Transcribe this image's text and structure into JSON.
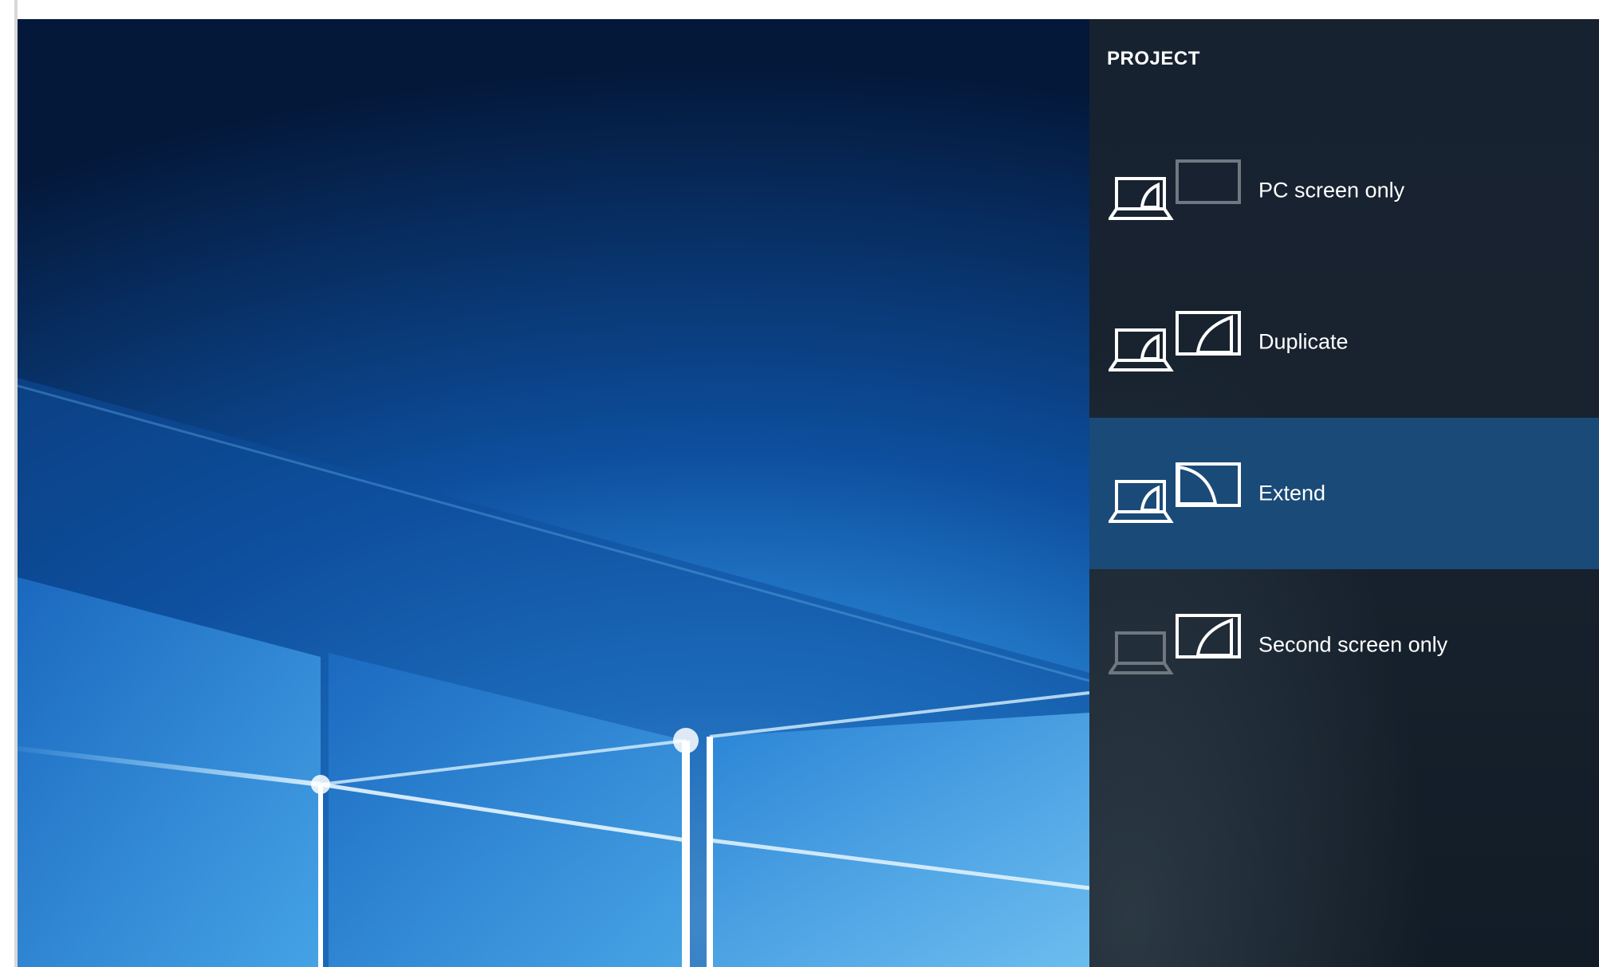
{
  "panel": {
    "title": "PROJECT",
    "selected_index": 2
  },
  "options": [
    {
      "label": "PC screen only",
      "icon": "pc-screen-only-icon"
    },
    {
      "label": "Duplicate",
      "icon": "duplicate-icon"
    },
    {
      "label": "Extend",
      "icon": "extend-icon"
    },
    {
      "label": "Second screen only",
      "icon": "second-screen-only-icon"
    }
  ],
  "colors": {
    "panel_background": "#18232f",
    "selected_background": "#1a4a77",
    "icon_active": "#ffffff",
    "icon_inactive": "#6f7880",
    "wallpaper_accent": "#2f8fe0"
  }
}
